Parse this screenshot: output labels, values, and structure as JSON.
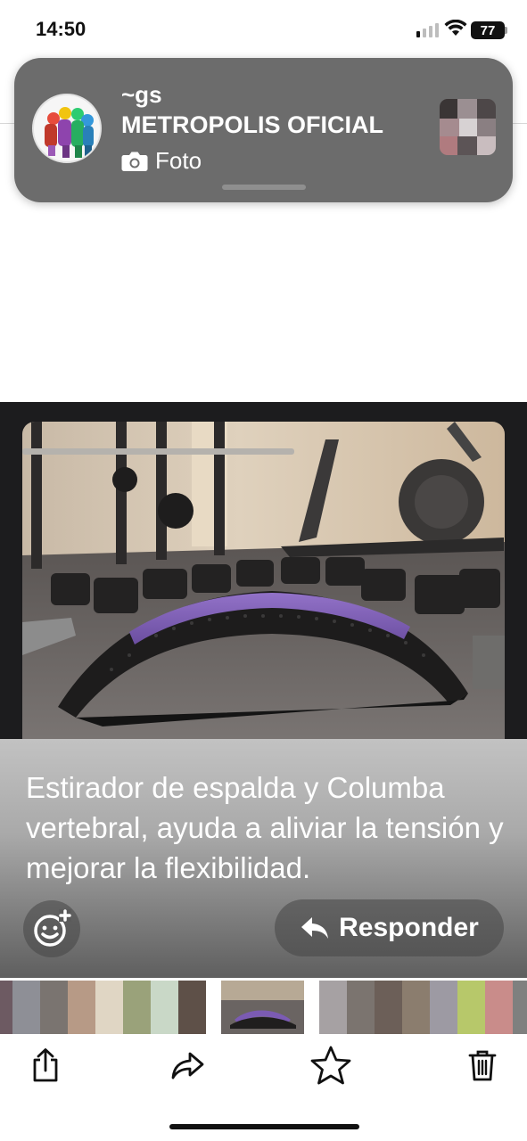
{
  "status_bar": {
    "time": "14:50",
    "battery": "77",
    "icons": [
      "cellular-signal-icon",
      "wifi-icon",
      "battery-icon"
    ]
  },
  "notification": {
    "sender": "~gs",
    "group_name": "METROPOLIS OFICIAL",
    "message_type": "Foto",
    "icons": [
      "group-avatar",
      "camera-icon",
      "photo-thumbnail"
    ]
  },
  "viewer": {
    "caption": "Estirador de espalda y Columba vertebral, ayuda a aliviar la tensión y mejorar la flexibilidad.",
    "reply_label": "Responder",
    "icons": [
      "add-reaction-icon",
      "reply-arrow-icon"
    ]
  },
  "thumbnail_strip": {
    "colors": [
      "#6d5a62",
      "#8e8f96",
      "#7a7470",
      "#b79a86",
      "#e0d6c4",
      "#9aa27a",
      "#c9d8c7",
      "#5e5048",
      "#f2f2f2",
      "#3f3a38",
      "#a6a1a3",
      "#7b746f",
      "#6c5f58",
      "#8b7d6e",
      "#9d9aa3",
      "#d9c7b9",
      "#b7c86a",
      "#c98c8a",
      "#7f807f"
    ]
  },
  "toolbar": {
    "icons": [
      "share-icon",
      "forward-icon",
      "star-icon",
      "trash-icon"
    ]
  },
  "colors": {
    "banner_background": "#6c6c6c",
    "viewer_background": "#1c1c1e",
    "accent_purple": "#7b5bb3"
  }
}
